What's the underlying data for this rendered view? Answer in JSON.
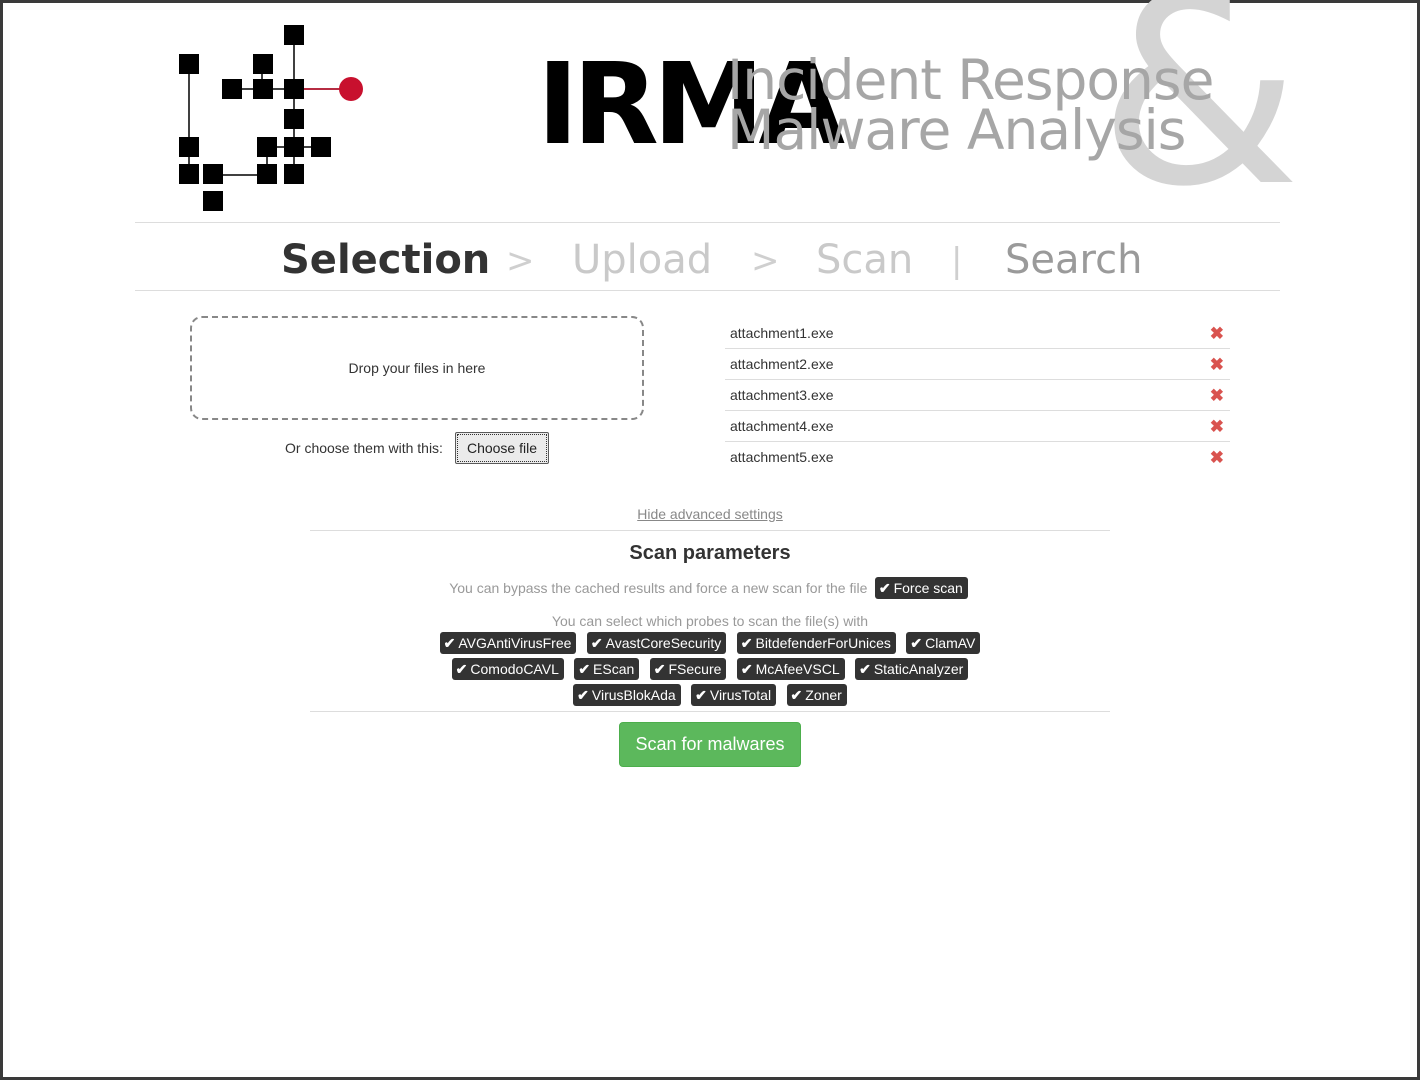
{
  "logo": {
    "text": "IRMA"
  },
  "tagline": {
    "line1": "Incident Response",
    "line2": "Malware Analysis",
    "ampersand": "&"
  },
  "nav": {
    "steps": [
      {
        "label": "Selection",
        "state": "active"
      },
      {
        "label": "Upload",
        "state": "inactive"
      },
      {
        "label": "Scan",
        "state": "inactive"
      }
    ],
    "step_separator": ">",
    "divider": "|",
    "search_label": "Search"
  },
  "upload": {
    "dropzone_text": "Drop your files in here",
    "choose_label": "Or choose them with this:",
    "choose_button": "Choose file"
  },
  "files": [
    {
      "name": "attachment1.exe",
      "remove_icon": "times-icon"
    },
    {
      "name": "attachment2.exe",
      "remove_icon": "times-icon"
    },
    {
      "name": "attachment3.exe",
      "remove_icon": "times-icon"
    },
    {
      "name": "attachment4.exe",
      "remove_icon": "times-icon"
    },
    {
      "name": "attachment5.exe",
      "remove_icon": "times-icon"
    }
  ],
  "advanced": {
    "toggle_link": "Hide advanced settings",
    "title": "Scan parameters",
    "force_text": "You can bypass the cached results and force a new scan for the file",
    "force_label": "Force scan",
    "probes_text": "You can select which probes to scan the file(s) with",
    "probes": [
      [
        "AVGAntiVirusFree",
        "AvastCoreSecurity",
        "BitdefenderForUnices",
        "ClamAV"
      ],
      [
        "ComodoCAVL",
        "EScan",
        "FSecure",
        "McAfeeVSCL",
        "StaticAnalyzer"
      ],
      [
        "VirusBlokAda",
        "VirusTotal",
        "Zoner"
      ]
    ]
  },
  "actions": {
    "scan_button": "Scan for malwares"
  },
  "colors": {
    "logo_dot": "#c8102e",
    "success": "#5cb85c",
    "danger": "#d9534f",
    "tag_bg": "#333333",
    "ampersand": "#d4d4d4",
    "tagline": "#a6a6a6"
  },
  "icons": {
    "check": "check-icon",
    "remove": "times-icon"
  }
}
